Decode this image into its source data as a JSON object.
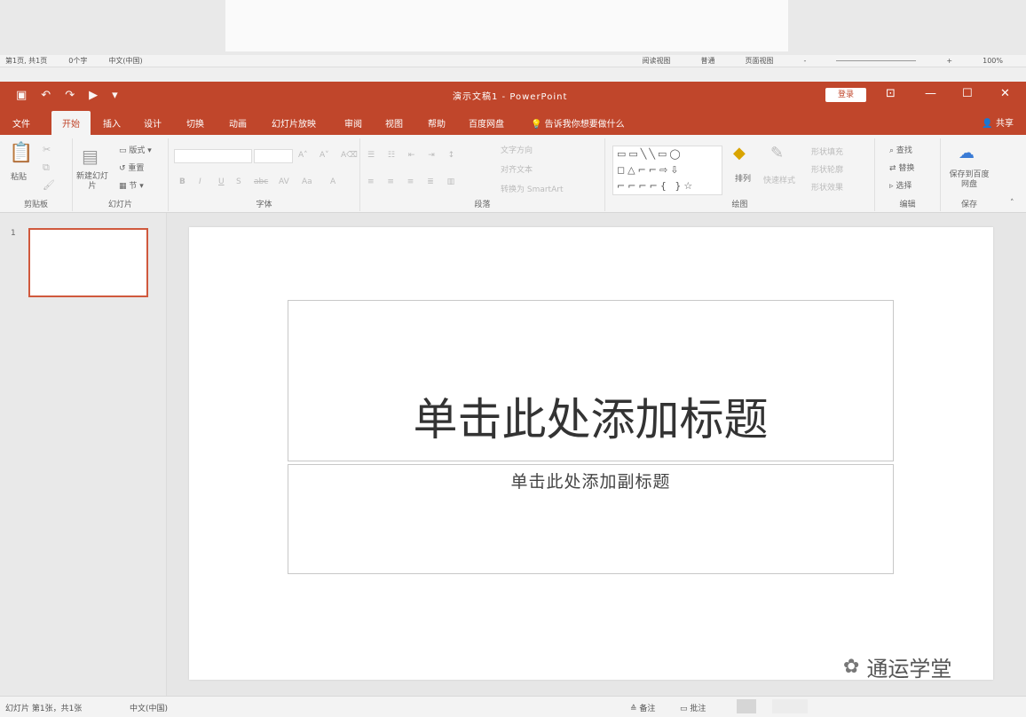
{
  "background_window": {
    "status_left": [
      "第1页, 共1页",
      "0个字",
      "中文(中国)"
    ],
    "status_right": [
      "阅读视图",
      "普通",
      "页面视图",
      "-",
      "+",
      "100%"
    ]
  },
  "quick_access": [
    "save-icon",
    "undo-icon",
    "redo-icon",
    "start-from-beginning-icon",
    "customize-icon"
  ],
  "quick_access_glyphs": [
    "▣",
    "↶",
    "↷",
    "▶",
    "▾"
  ],
  "title": "演示文稿1 - PowerPoint",
  "login_label": "登录",
  "window_controls": {
    "restore_ribbon": "⊡",
    "minimize": "—",
    "maximize": "☐",
    "close": "✕"
  },
  "tabs": [
    {
      "label": "文件"
    },
    {
      "label": "开始"
    },
    {
      "label": "插入"
    },
    {
      "label": "设计"
    },
    {
      "label": "切换"
    },
    {
      "label": "动画"
    },
    {
      "label": "幻灯片放映"
    },
    {
      "label": "审阅"
    },
    {
      "label": "视图"
    },
    {
      "label": "帮助"
    },
    {
      "label": "百度网盘"
    }
  ],
  "tell_me": "告诉我你想要做什么",
  "share_label": "共享",
  "ribbon": {
    "clipboard": {
      "paste": "粘贴",
      "label": "剪贴板"
    },
    "slides": {
      "new_slide": "新建幻灯片",
      "layout": "版式",
      "reset": "重置",
      "section": "节",
      "label": "幻灯片"
    },
    "font": {
      "label": "字体",
      "format_buttons": [
        "B",
        "I",
        "U",
        "S",
        "abc",
        "AV",
        "Aa",
        "A"
      ]
    },
    "paragraph": {
      "label": "段落",
      "text_direction": "文字方向",
      "align_text": "对齐文本",
      "smartart": "转换为 SmartArt"
    },
    "drawing": {
      "arrange": "排列",
      "quick_styles": "快速样式",
      "shape_fill": "形状填充",
      "shape_outline": "形状轮廓",
      "shape_effects": "形状效果",
      "label": "绘图"
    },
    "editing": {
      "find": "查找",
      "replace": "替换",
      "select": "选择",
      "label": "编辑"
    },
    "save": {
      "button": "保存到百度网盘",
      "label": "保存"
    }
  },
  "thumbnail_number": "1",
  "slide": {
    "title_placeholder": "单击此处添加标题",
    "subtitle_placeholder": "单击此处添加副标题"
  },
  "watermark": "通运学堂",
  "status_bar": {
    "slide_info": "幻灯片 第1张，共1张",
    "language": "中文(中国)",
    "notes": "备注",
    "comments": "批注"
  }
}
